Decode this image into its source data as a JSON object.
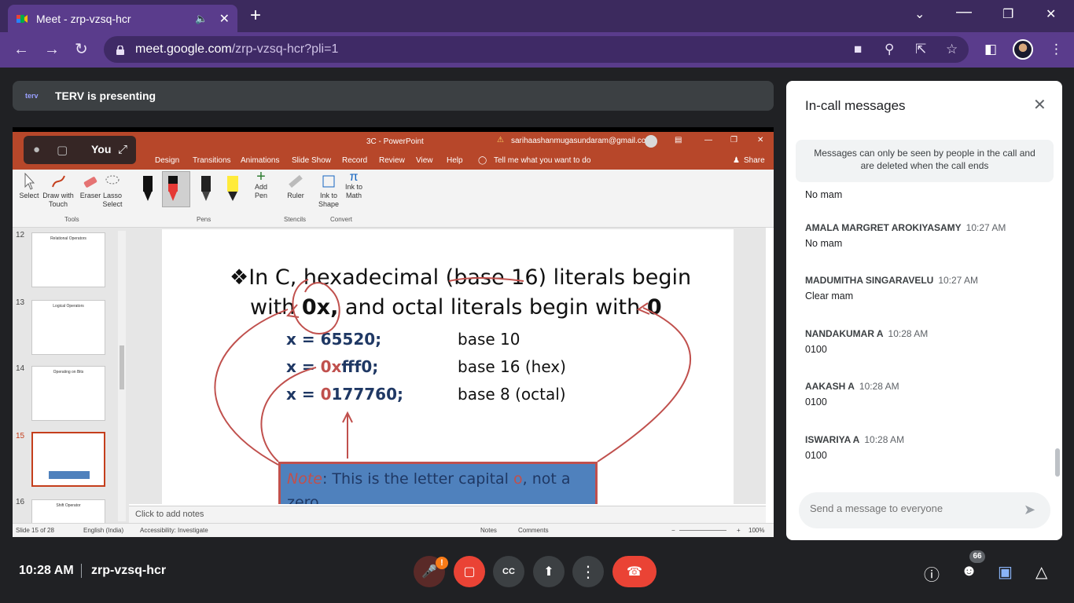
{
  "browser": {
    "tab_title": "Meet - zrp-vzsq-hcr",
    "url_host": "meet.google.com",
    "url_path": "/zrp-vzsq-hcr?pli=1"
  },
  "presenting": {
    "logo": "terv",
    "text": "TERV is presenting"
  },
  "self_tile": {
    "name": "You"
  },
  "ppt": {
    "title": "3C - PowerPoint",
    "user": "sarihaashanmugasundaram@gmail.com",
    "menu": [
      "Design",
      "Transitions",
      "Animations",
      "Slide Show",
      "Record",
      "Review",
      "View",
      "Help"
    ],
    "tell_me": "Tell me what you want to do",
    "share": "Share",
    "ribbon": {
      "select": "Select",
      "draw_touch": "Draw with Touch",
      "eraser": "Eraser",
      "lasso": "Lasso Select",
      "add_pen": "Add Pen",
      "ruler": "Ruler",
      "ink_shape": "Ink to Shape",
      "ink_math": "Ink to Math",
      "group_tools": "Tools",
      "group_pens": "Pens",
      "group_stencils": "Stencils",
      "group_convert": "Convert"
    },
    "thumbnails": [
      {
        "num": "12",
        "title": "Relational Operators"
      },
      {
        "num": "13",
        "title": "Logical Operators"
      },
      {
        "num": "14",
        "title": "Operating on Bits"
      },
      {
        "num": "15",
        "title": ""
      },
      {
        "num": "16",
        "title": "Shift Operator"
      }
    ],
    "slide": {
      "line1": "❖In C, hexadecimal (base 16) literals begin",
      "line2_a": "with ",
      "line2_b": "0x,",
      "line2_c": " and octal literals begin with ",
      "line2_d": "0",
      "rows": [
        {
          "code_pre": "x = ",
          "code_red": "",
          "code_post": "65520;",
          "base": "base 10"
        },
        {
          "code_pre": "x = ",
          "code_red": "0x",
          "code_post": "fff0;",
          "base": "base 16 (hex)"
        },
        {
          "code_pre": "x = ",
          "code_red": "0",
          "code_post": "177760;",
          "base": "base 8 (octal)"
        }
      ],
      "note_label": "Note",
      "note_text_a": ": This is the letter capital ",
      "note_text_b": "o",
      "note_text_c": ", not a zero"
    },
    "notes_placeholder": "Click to add notes",
    "status": {
      "slide": "Slide 15 of 28",
      "language": "English (India)",
      "accessibility": "Accessibility: Investigate",
      "notes": "Notes",
      "comments": "Comments",
      "zoom": "100%"
    }
  },
  "chat": {
    "title": "In-call messages",
    "notice": "Messages can only be seen by people in the call and are deleted when the call ends",
    "partial_text": "No mam",
    "messages": [
      {
        "sender": "AMALA MARGRET AROKIYASAMY",
        "time": "10:27 AM",
        "text": "No mam"
      },
      {
        "sender": "MADUMITHA SINGARAVELU",
        "time": "10:27 AM",
        "text": "Clear mam"
      },
      {
        "sender": "NANDAKUMAR A",
        "time": "10:28 AM",
        "text": "0100"
      },
      {
        "sender": "AAKASH A",
        "time": "10:28 AM",
        "text": "0100"
      },
      {
        "sender": "ISWARIYA A",
        "time": "10:28 AM",
        "text": "0100"
      }
    ],
    "input_placeholder": "Send a message to everyone"
  },
  "bottom": {
    "time": "10:28 AM",
    "meeting_code": "zrp-vzsq-hcr",
    "mic_alert": "!",
    "people_count": "66"
  },
  "colors": {
    "tab_bar": "#3c2a5e",
    "address_bar": "#5a3c8c",
    "meet_bg": "#202124",
    "ppt_accent": "#b7472a",
    "hangup_red": "#ea4335",
    "ink_red": "#c0504d"
  }
}
